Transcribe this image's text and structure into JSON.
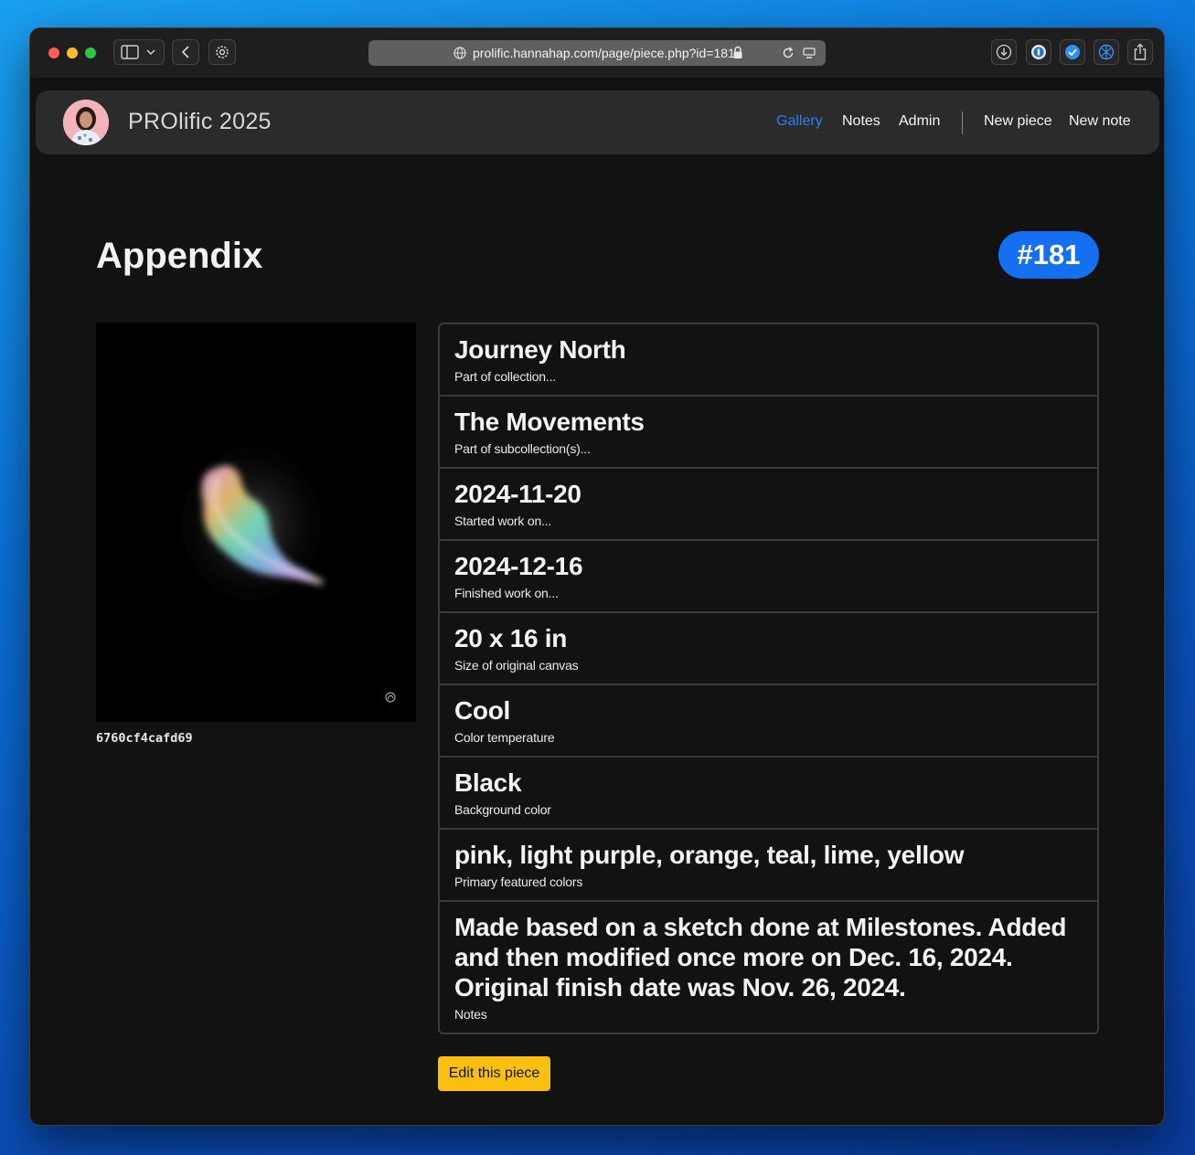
{
  "browser": {
    "url": "prolific.hannahap.com/page/piece.php?id=181"
  },
  "nav": {
    "brand": "PROlific 2025",
    "links": [
      "Gallery",
      "Notes",
      "Admin"
    ],
    "actions": [
      "New piece",
      "New note"
    ],
    "active": "Gallery",
    "accent_color": "#2e7cf6"
  },
  "page": {
    "title": "Appendix",
    "badge": "#181",
    "badge_color": "#1470f0",
    "image_hash": "6760cf4cafd69",
    "edit_button": "Edit this piece",
    "edit_button_color": "#fbbf10"
  },
  "details": [
    {
      "value": "Journey North",
      "label": "Part of collection..."
    },
    {
      "value": "The Movements",
      "label": "Part of subcollection(s)..."
    },
    {
      "value": "2024-11-20",
      "label": "Started work on..."
    },
    {
      "value": "2024-12-16",
      "label": "Finished work on..."
    },
    {
      "value": "20 x 16 in",
      "label": "Size of original canvas"
    },
    {
      "value": "Cool",
      "label": "Color temperature"
    },
    {
      "value": "Black",
      "label": "Background color"
    },
    {
      "value": "pink, light purple, orange, teal, lime, yellow",
      "label": "Primary featured colors"
    },
    {
      "value": "Made based on a sketch done at Milestones. Added and then modified once more on Dec. 16, 2024. Original finish date was Nov. 26, 2024.",
      "label": "Notes"
    }
  ]
}
